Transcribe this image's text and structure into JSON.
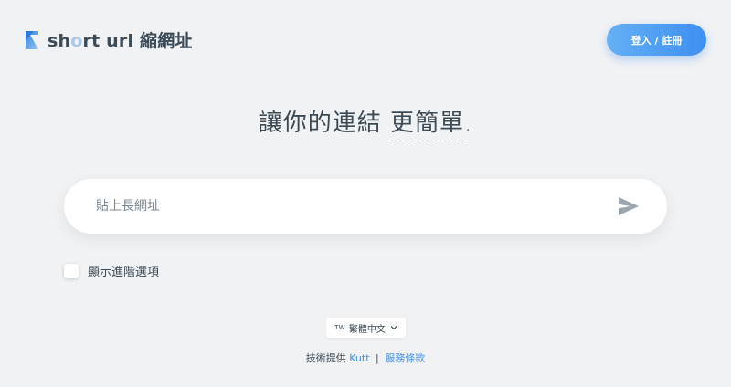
{
  "header": {
    "logo_prefix": "sh",
    "logo_highlight": "o",
    "logo_rest": "rt url 縮網址",
    "login_label": "登入 / 註冊"
  },
  "hero": {
    "headline_main": "讓你的連結 ",
    "headline_accent": "更簡單",
    "headline_end": "."
  },
  "url_form": {
    "placeholder": "貼上長網址",
    "value": ""
  },
  "options": {
    "advanced_label": "顯示進階選項",
    "advanced_checked": false
  },
  "language": {
    "code": "TW",
    "selected": "繁體中文"
  },
  "footer": {
    "powered_prefix": "技術提供",
    "powered_link": "Kutt",
    "separator": "|",
    "terms_link": "服務條款"
  },
  "colors": {
    "background": "#f1f2f4",
    "accent_blue": "#3e8ff1",
    "text": "#3d4b55"
  },
  "icons": {
    "logo": "logo-icon",
    "submit": "send-icon",
    "chevron": "chevron-down-icon"
  }
}
